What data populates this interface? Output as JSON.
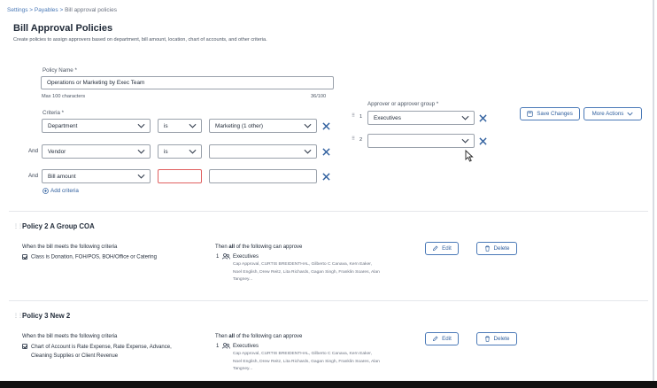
{
  "breadcrumb": {
    "settings": "Settings",
    "sep1": " > ",
    "payables": "Payables",
    "sep2": " > ",
    "current": "Bill approval policies"
  },
  "page": {
    "title": "Bill Approval Policies",
    "subtitle": "Create policies to assign approvers based on department, bill amount, location, chart of accounts, and other criteria."
  },
  "editor": {
    "policy_name_label": "Policy Name *",
    "policy_name_value": "Operations or Marketing by Exec Team",
    "max_chars": "Max 100 characters",
    "char_count": "36/100",
    "criteria_label": "Criteria *",
    "rows": [
      {
        "prefix": "",
        "field": "Department",
        "op": "is",
        "value": "Marketing (1 other)"
      },
      {
        "prefix": "And",
        "field": "Vendor",
        "op": "is",
        "value": ""
      },
      {
        "prefix": "And",
        "field": "Bill amount",
        "op": "",
        "value": ""
      }
    ],
    "add_criteria": "Add criteria",
    "approver_label": "Approver or approver group *",
    "approvers": [
      {
        "order": "1",
        "value": "Executives"
      },
      {
        "order": "2",
        "value": ""
      }
    ],
    "save_label": "Save Changes",
    "more_label": "More Actions"
  },
  "policies": [
    {
      "title": "Policy 2 A Group COA",
      "criteria_head": "When the bill meets the following criteria",
      "criteria": [
        "Class is Donation, FOH/POS, BOH/Office or Catering"
      ],
      "approve_head_pre": "Then ",
      "approve_head_bold": "all",
      "approve_head_post": " of the following can approve",
      "order": "1",
      "group": "Executives",
      "members": [
        "Cap Approval, CURTIS BREIDENTHAL, Gilberto C Canava, Kern Eaker,",
        "Noel English, Drew Reitz, Lita Richards, Gagan Singh, Franklin Soares, Alan",
        "Tangney..."
      ],
      "edit": "Edit",
      "delete": "Delete"
    },
    {
      "title": "Policy 3 New 2",
      "criteria_head": "When the bill meets the following criteria",
      "criteria": [
        "Chart of Account is Rate Expense, Rate Expense, Advance,",
        "Cleaning Supplies or Client Revenue"
      ],
      "approve_head_pre": "Then ",
      "approve_head_bold": "all",
      "approve_head_post": " of the following can approve",
      "order": "1",
      "group": "Executives",
      "members": [
        "Cap Approval, CURTIS BREIDENTHAL, Gilberto C Canava, Kern Eaker,",
        "Noel English, Drew Reitz, Lita Richards, Gagan Singh, Franklin Soares, Alan",
        "Tangney..."
      ],
      "edit": "Edit",
      "delete": "Delete"
    }
  ],
  "colors": {
    "accent": "#2f5f9e",
    "error": "#e06060"
  }
}
